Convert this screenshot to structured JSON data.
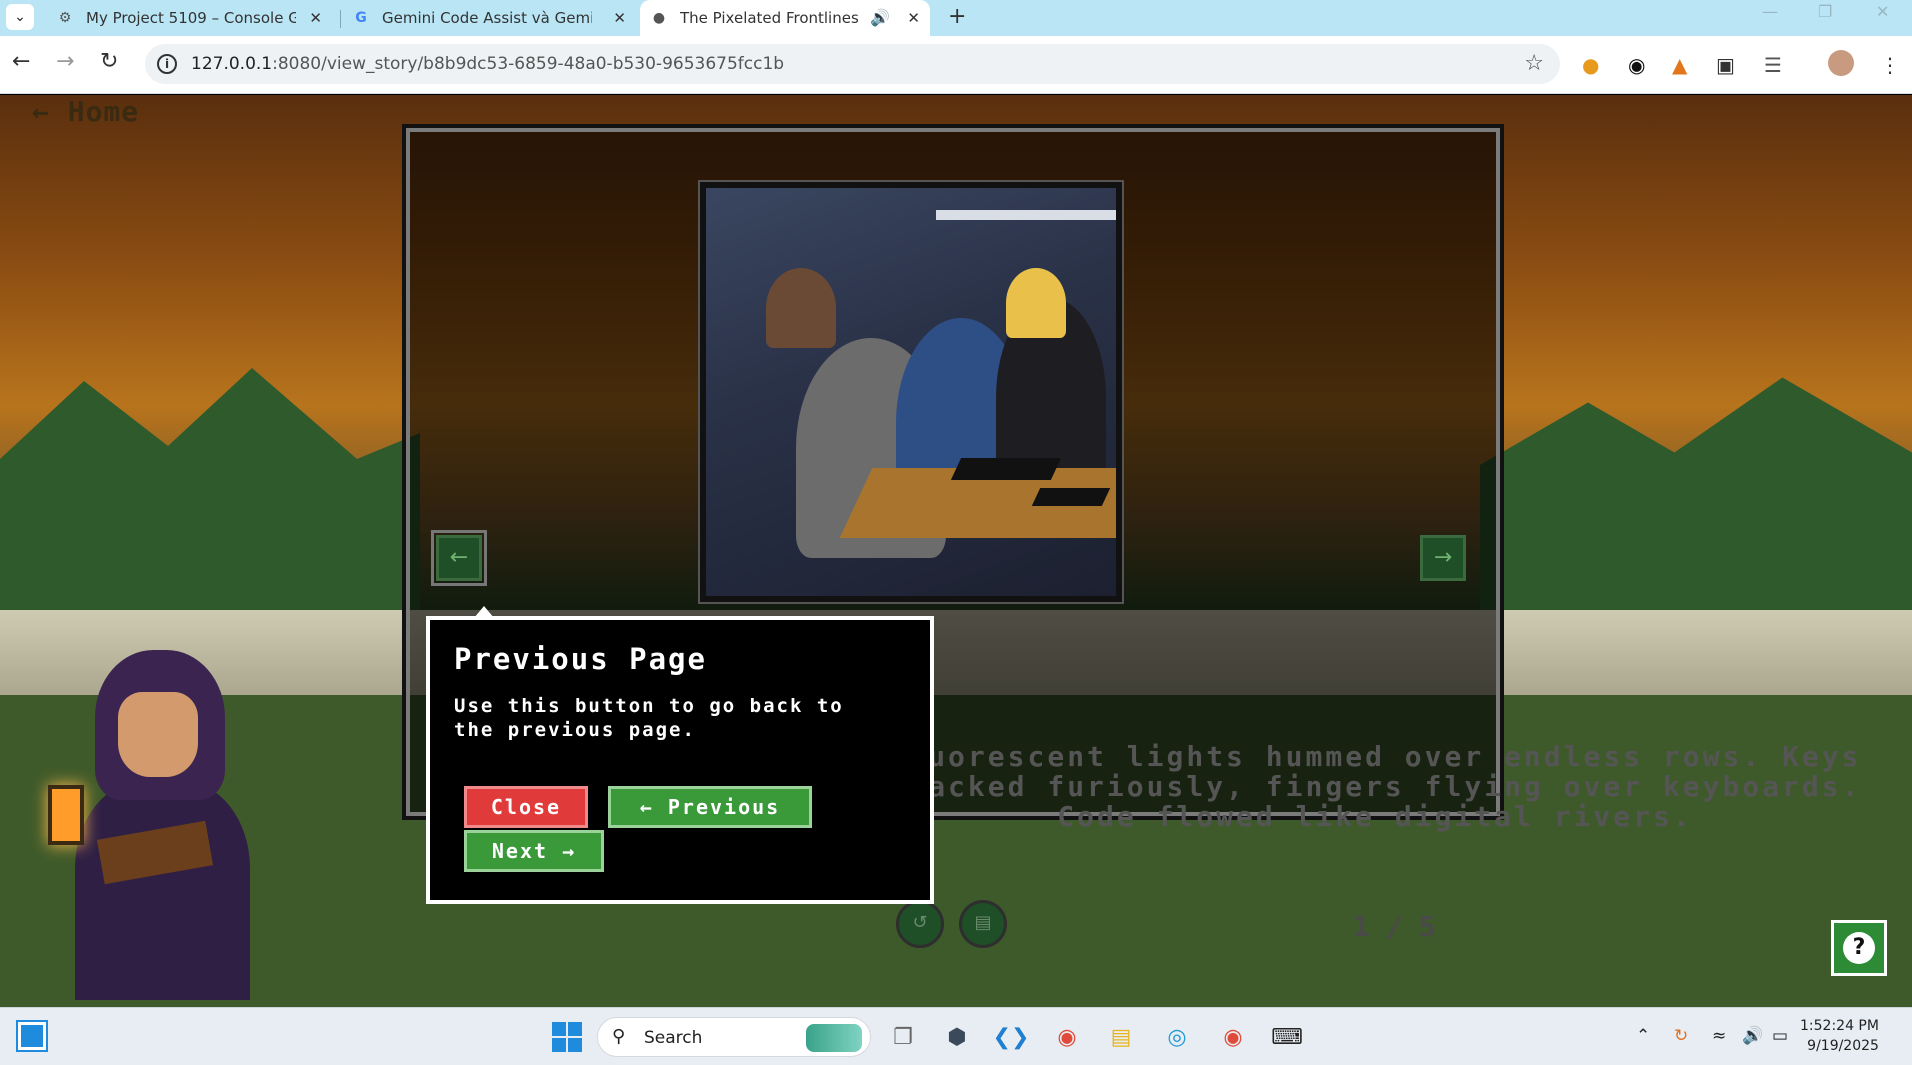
{
  "browser": {
    "tabs": [
      {
        "title": "My Project 5109 – Console Goo",
        "icon": "gear-icon",
        "active": false
      },
      {
        "title": "Gemini Code Assist và Gemini C",
        "icon": "google-icon",
        "active": false
      },
      {
        "title": "The Pixelated Frontlines",
        "icon": "globe-icon",
        "active": true
      }
    ],
    "url_host": "127.0.0.1",
    "url_path": ":8080/view_story/b8b9dc53-6859-48a0-b530-9653675fcc1b"
  },
  "page": {
    "home_label": "← Home",
    "story_text": "Fluorescent lights hummed over endless rows. Keys clacked furiously, fingers flying over keyboards. Code flowed like digital rivers.",
    "prev_arrow": "←",
    "next_arrow": "→",
    "share_icon": "share-icon",
    "pdf_icon": "pdf-icon",
    "page_current": "1",
    "page_sep": "/",
    "page_total": "5",
    "help_label": "?"
  },
  "popover": {
    "title": "Previous Page",
    "description": "Use this button to go back to the previous page.",
    "close_label": "Close",
    "previous_label": "← Previous",
    "next_label": "Next →"
  },
  "taskbar": {
    "search_label": "Search",
    "time": "1:52:24 PM",
    "date": "9/19/2025"
  },
  "colors": {
    "accent_green": "#3a9a3a",
    "close_red": "#e03a3a",
    "tabbar_bg": "#b9e5f5"
  }
}
